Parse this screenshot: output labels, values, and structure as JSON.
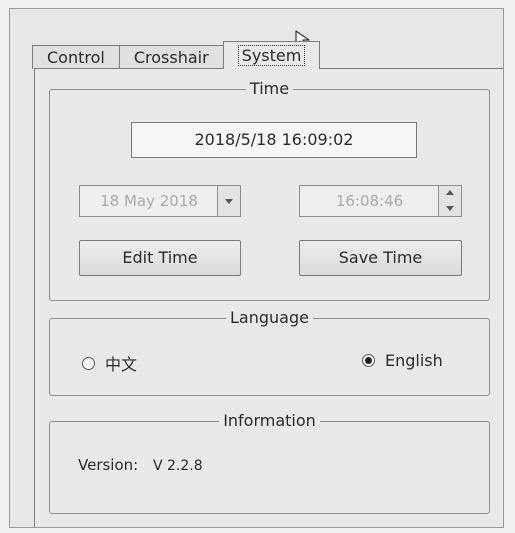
{
  "tabs": [
    {
      "label": "Control",
      "active": false
    },
    {
      "label": "Crosshair",
      "active": false
    },
    {
      "label": "System",
      "active": true
    }
  ],
  "time_group": {
    "title": "Time",
    "current_datetime": "2018/5/18  16:09:02",
    "date_value": "18 May 2018",
    "time_value": "16:08:46",
    "edit_button": "Edit Time",
    "save_button": "Save Time"
  },
  "language_group": {
    "title": "Language",
    "options": [
      {
        "label": "中文",
        "selected": false
      },
      {
        "label": "English",
        "selected": true
      }
    ]
  },
  "info_group": {
    "title": "Information",
    "version_label": "Version:",
    "version_value": "V 2.2.8"
  },
  "icons": {
    "cursor": "mouse-pointer-icon",
    "date_dropdown": "chevron-down-icon",
    "spin_up": "chevron-up-icon",
    "spin_down": "chevron-down-icon"
  }
}
